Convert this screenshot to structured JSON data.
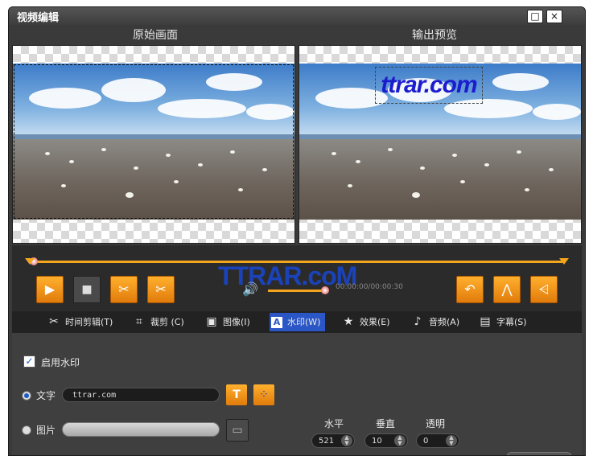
{
  "window": {
    "title": "视频编辑",
    "buttons": [
      {
        "name": "maximize",
        "glyph": "□"
      },
      {
        "name": "close",
        "glyph": "×"
      }
    ]
  },
  "preview": {
    "original_label": "原始画面",
    "output_label": "输出预览",
    "watermark_text": "ttrar.com"
  },
  "playback": {
    "brand_logo": "TTRAR.coM",
    "timecode": "00:00:00/00:00:30",
    "buttons": [
      {
        "name": "play",
        "glyph": "▶"
      },
      {
        "name": "stop",
        "glyph": "■"
      },
      {
        "name": "cut",
        "glyph": "✂"
      },
      {
        "name": "split",
        "glyph": "✂"
      },
      {
        "name": "undo",
        "glyph": "↶"
      },
      {
        "name": "flip",
        "glyph": "⋀"
      },
      {
        "name": "rotate",
        "glyph": "⩤"
      }
    ],
    "volume_icon": "speaker-icon"
  },
  "tabs": [
    {
      "label": "时间剪辑(T)",
      "icon": "✂"
    },
    {
      "label": "裁剪 (C)",
      "icon": "⌗"
    },
    {
      "label": "图像(I)",
      "icon": "▣"
    },
    {
      "label": "水印(W)",
      "icon": "A",
      "active": true
    },
    {
      "label": "效果(E)",
      "icon": "★"
    },
    {
      "label": "音频(A)",
      "icon": "♪"
    },
    {
      "label": "字幕(S)",
      "icon": "▤"
    }
  ],
  "watermark": {
    "enable_label": "启用水印",
    "enabled": true,
    "text_label": "文字",
    "text_value": "ttrar.com",
    "image_label": "图片",
    "text_selected": true,
    "horizontal_label": "水平",
    "horizontal_value": "521",
    "vertical_label": "垂直",
    "vertical_value": "10",
    "opacity_label": "透明",
    "opacity_value": "0"
  },
  "colors": {
    "accent": "#f3a51d",
    "active_tab": "#2b56c5",
    "watermark_text": "#1c1ccf"
  }
}
